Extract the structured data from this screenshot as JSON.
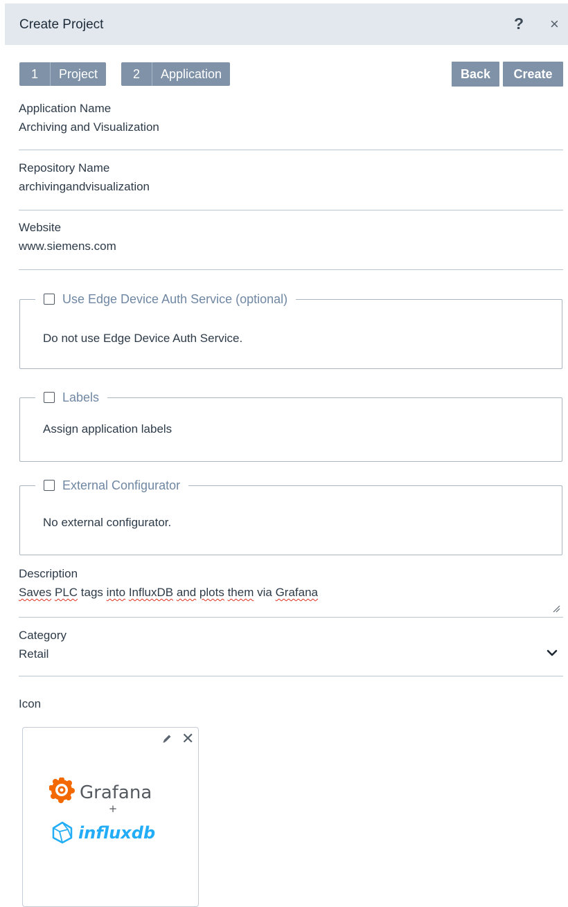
{
  "dialog": {
    "title": "Create Project",
    "help_icon": "?",
    "close_icon": "×"
  },
  "steps": [
    {
      "number": "1",
      "label": "Project"
    },
    {
      "number": "2",
      "label": "Application"
    }
  ],
  "actions": {
    "back": "Back",
    "create": "Create"
  },
  "fields": {
    "app_name": {
      "label": "Application Name",
      "value": "Archiving and Visualization"
    },
    "repo_name": {
      "label": "Repository Name",
      "value": "archivingandvisualization"
    },
    "website": {
      "label": "Website",
      "value": "www.siemens.com"
    }
  },
  "fieldsets": {
    "auth": {
      "legend": "Use Edge Device Auth Service (optional)",
      "text": "Do not use Edge Device Auth Service."
    },
    "labels": {
      "legend": "Labels",
      "text": "Assign application labels"
    },
    "configurator": {
      "legend": "External Configurator",
      "text": "No external configurator."
    }
  },
  "description": {
    "label": "Description",
    "words": [
      "Saves",
      "PLC",
      "tags",
      "into",
      "InfluxDB",
      "and",
      "plots",
      "them",
      "via",
      "Grafana"
    ]
  },
  "category": {
    "label": "Category",
    "value": "Retail"
  },
  "icon": {
    "label": "Icon",
    "brand1": "Grafana",
    "plus": "+",
    "brand2": "influxdb"
  },
  "colors": {
    "header_bg": "#e3e8ef",
    "step_bg": "#7f92a7",
    "legend_text": "#6f87a3",
    "grafana": "#f46800",
    "influx": "#22adf6"
  }
}
